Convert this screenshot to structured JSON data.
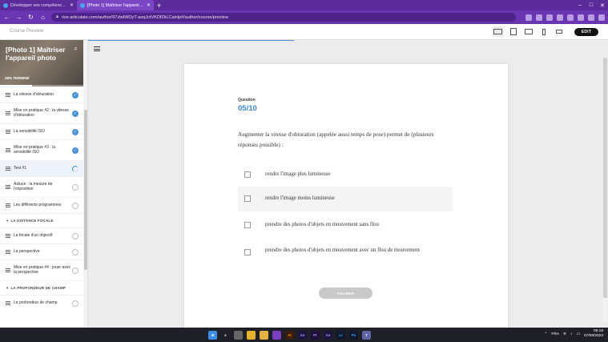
{
  "browser": {
    "tabs": [
      {
        "title": "Développer ses compétences m",
        "active": false
      },
      {
        "title": "[Photo 1] Maîtriser l'appareil pho",
        "active": true
      }
    ],
    "url": "rise.articulate.com/author/97zbdWOyT-aoqJctVKDfZkLCainlp#/author/course/preview"
  },
  "course_bar": {
    "title": "Course Preview",
    "edit_label": "EDIT",
    "devices": [
      "desktop-view",
      "tablet-landscape-view",
      "tablet-portrait-view",
      "mobile-view",
      "presentation-view"
    ]
  },
  "sidebar": {
    "course_title": "[Photo 1] Maîtriser l'appareil photo",
    "progress_label": "38% TERMINÉ",
    "progress_fraction": 0.38,
    "items": [
      {
        "type": "lesson",
        "label": "La vitesse d'obturation",
        "status": "done"
      },
      {
        "type": "lesson",
        "label": "Mise en pratique #2 : la vitesse d'obturation",
        "status": "done"
      },
      {
        "type": "lesson",
        "label": "La sensibilité ISO",
        "status": "done"
      },
      {
        "type": "lesson",
        "label": "Mise en pratique #3 : la sensibilité ISO",
        "status": "done"
      },
      {
        "type": "lesson",
        "label": "Test #1",
        "status": "in-progress",
        "current": true
      },
      {
        "type": "lesson",
        "label": "Astuce : la mesure de l'exposition",
        "status": "todo"
      },
      {
        "type": "lesson",
        "label": "Les différents programmes",
        "status": "todo"
      },
      {
        "type": "section",
        "label": "LA DISTANCE FOCALE"
      },
      {
        "type": "lesson",
        "label": "La focale d'un objectif",
        "status": "todo"
      },
      {
        "type": "lesson",
        "label": "La perspective",
        "status": "todo"
      },
      {
        "type": "lesson",
        "label": "Mise en pratique #4 : jouer avec la perspective",
        "status": "todo"
      },
      {
        "type": "section",
        "label": "LA PROFONDEUR DE CHAMP"
      },
      {
        "type": "lesson",
        "label": "La profondeur de champ",
        "status": "todo"
      }
    ]
  },
  "quiz": {
    "label": "Question",
    "number": "05/10",
    "question": "Augmenter la vitesse d'obturation (appelée aussi temps de pose) permet de (plusieurs réponses possible) :",
    "choices": [
      "rendre l'image plus lumineuse",
      "rendre l'image moins lumineuse",
      "prendre des photos d'objets en mouvement sans flou",
      "prendre des photos d'objets en mouvement avec un flou de mouvement"
    ],
    "submit_label": "VALIDER"
  },
  "taskbar": {
    "apps": [
      "start",
      "search",
      "task-view",
      "chrome",
      "explorer",
      "visual-studio",
      "illustrator",
      "after-effects",
      "premiere",
      "after-effects",
      "lightroom",
      "photoshop",
      "teams"
    ],
    "language": "FRA",
    "time": "09:18",
    "date": "07/08/2023"
  }
}
